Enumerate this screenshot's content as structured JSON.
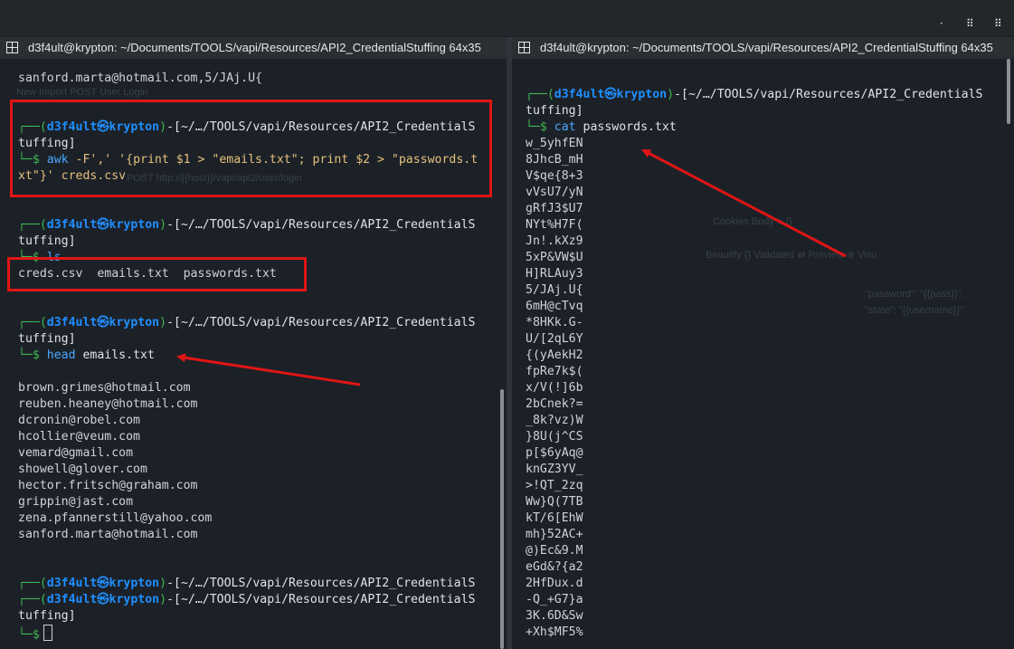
{
  "window": {
    "controls": [
      "·",
      "⠿",
      "⠿"
    ]
  },
  "left_pane": {
    "title": "d3f4ult@krypton: ~/Documents/TOOLS/vapi/Resources/API2_CredentialStuffing 64x35",
    "prev_output": "sanford.marta@hotmail.com,5/JAj.U{",
    "prompt_user": "d3f4ult",
    "prompt_host": "krypton",
    "prompt_path_a": "-[~/…/TOOLS/vapi/Resources/API2_CredentialS",
    "prompt_path_b": "tuffing]",
    "prompt_symbol": "└─$",
    "cmd1": {
      "name": "awk",
      "line1_args": " -F',' '{print $1 > \"emails.txt\"; print $2 > \"passwords.t",
      "line2_args": "xt\"}' creds.csv"
    },
    "cmd2": {
      "name": "ls"
    },
    "ls_output": "creds.csv  emails.txt  passwords.txt",
    "cmd3": {
      "name": "head",
      "arg": " emails.txt"
    },
    "emails": [
      "brown.grimes@hotmail.com",
      "reuben.heaney@hotmail.com",
      "dcronin@robel.com",
      "hcollier@veum.com",
      "vemard@gmail.com",
      "showell@glover.com",
      "hector.fritsch@graham.com",
      "grippin@jast.com",
      "zena.pfannerstill@yahoo.com",
      "sanford.marta@hotmail.com"
    ]
  },
  "right_pane": {
    "title": "d3f4ult@krypton: ~/Documents/TOOLS/vapi/Resources/API2_CredentialStuffing 64x35",
    "cmd": {
      "name": "cat",
      "arg": " passwords.txt"
    },
    "passwords": [
      "w_5yhfEN",
      "8JhcB_mH",
      "V$qe{8+3",
      "vVsU7/yN",
      "gRfJ3$U7",
      "NYt%H7F(",
      "Jn!.kXz9",
      "5xP&VW$U",
      "H]RLAuy3",
      "5/JAj.U{",
      "6mH@cTvq",
      "*8HKk.G-",
      "U/[2qL6Y",
      "{(yAekH2",
      "fpRe7k$(",
      "x/V(!]6b",
      "2bCnek?=",
      "_8k?vz)W",
      "}8U(j^CS",
      "p[$6yAq@",
      "knGZ3YV_",
      ">!QT_2zq",
      "Ww}Q(7TB",
      "kT/6[EhW",
      "mh}52AC+",
      "@)Ec&9.M",
      "eGd&?{a2",
      "2HfDux.d",
      "-Q_+G7}a",
      "3K.6D&Sw",
      "+Xh$MF5%"
    ]
  },
  "ghost_text": {
    "l1": "New   Import       POST  User Login",
    "l2": "POST        http://{{host}}/vapi/api2/user/login",
    "l3": "Cookies    Body ●    {}",
    "l4": "Beautify    {} Validated    ⇄ Preview    ⊕ Visu",
    "l5": "\"password\": \"{{pass}}\",",
    "l6": "\"state\": \"{{username}}\""
  },
  "colors": {
    "prompt_frame": "#3fb950",
    "user_host": "#1f8fff",
    "command": "#4aa8ff",
    "string": "#e5c07b",
    "highlight_box": "#e01515",
    "arrow": "#e01515"
  }
}
